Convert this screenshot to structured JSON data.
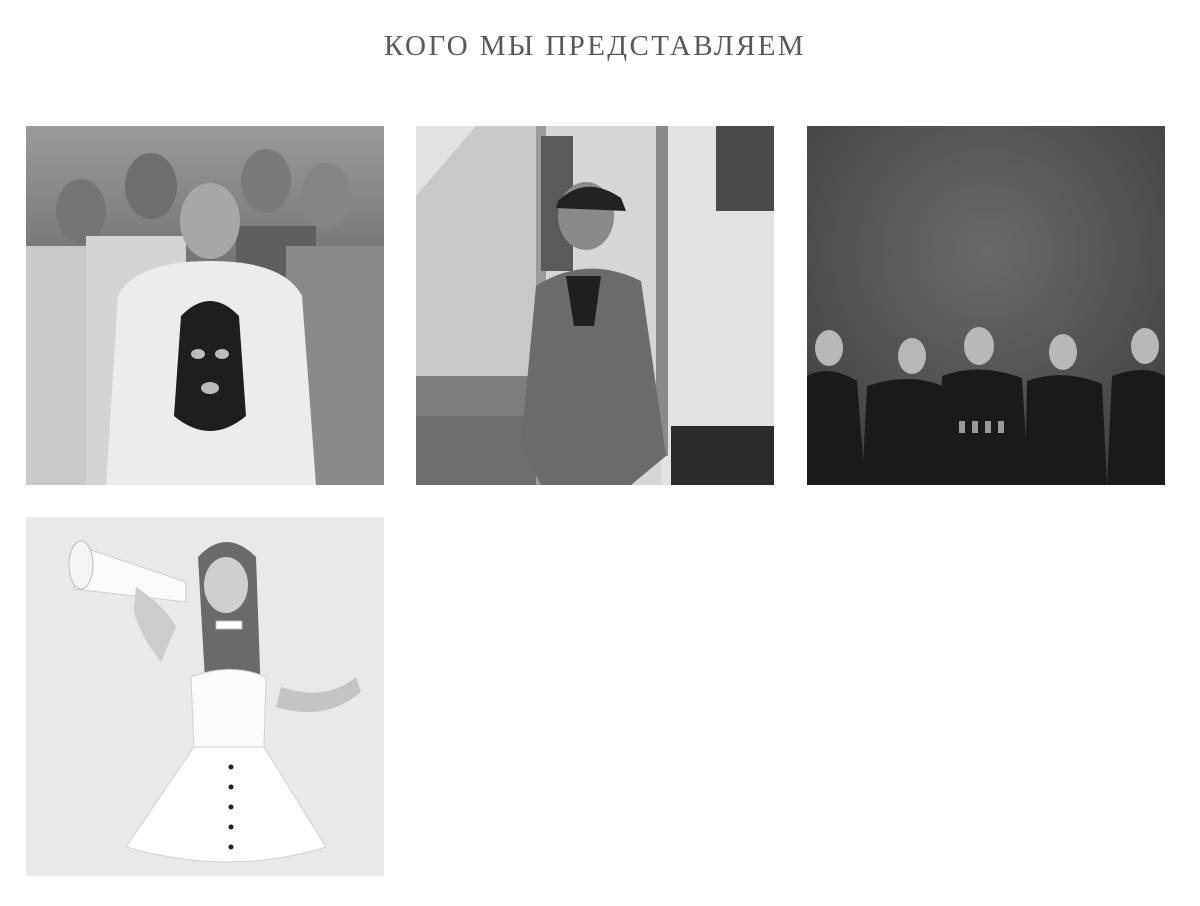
{
  "section": {
    "title": "КОГО МЫ ПРЕДСТАВЛЯЕМ"
  },
  "artists": [
    {
      "photo": "band-group-photo"
    },
    {
      "photo": "solo-artist-cap-photo"
    },
    {
      "photo": "band-dark-backdrop-photo"
    },
    {
      "photo": "singer-megaphone-photo"
    }
  ]
}
